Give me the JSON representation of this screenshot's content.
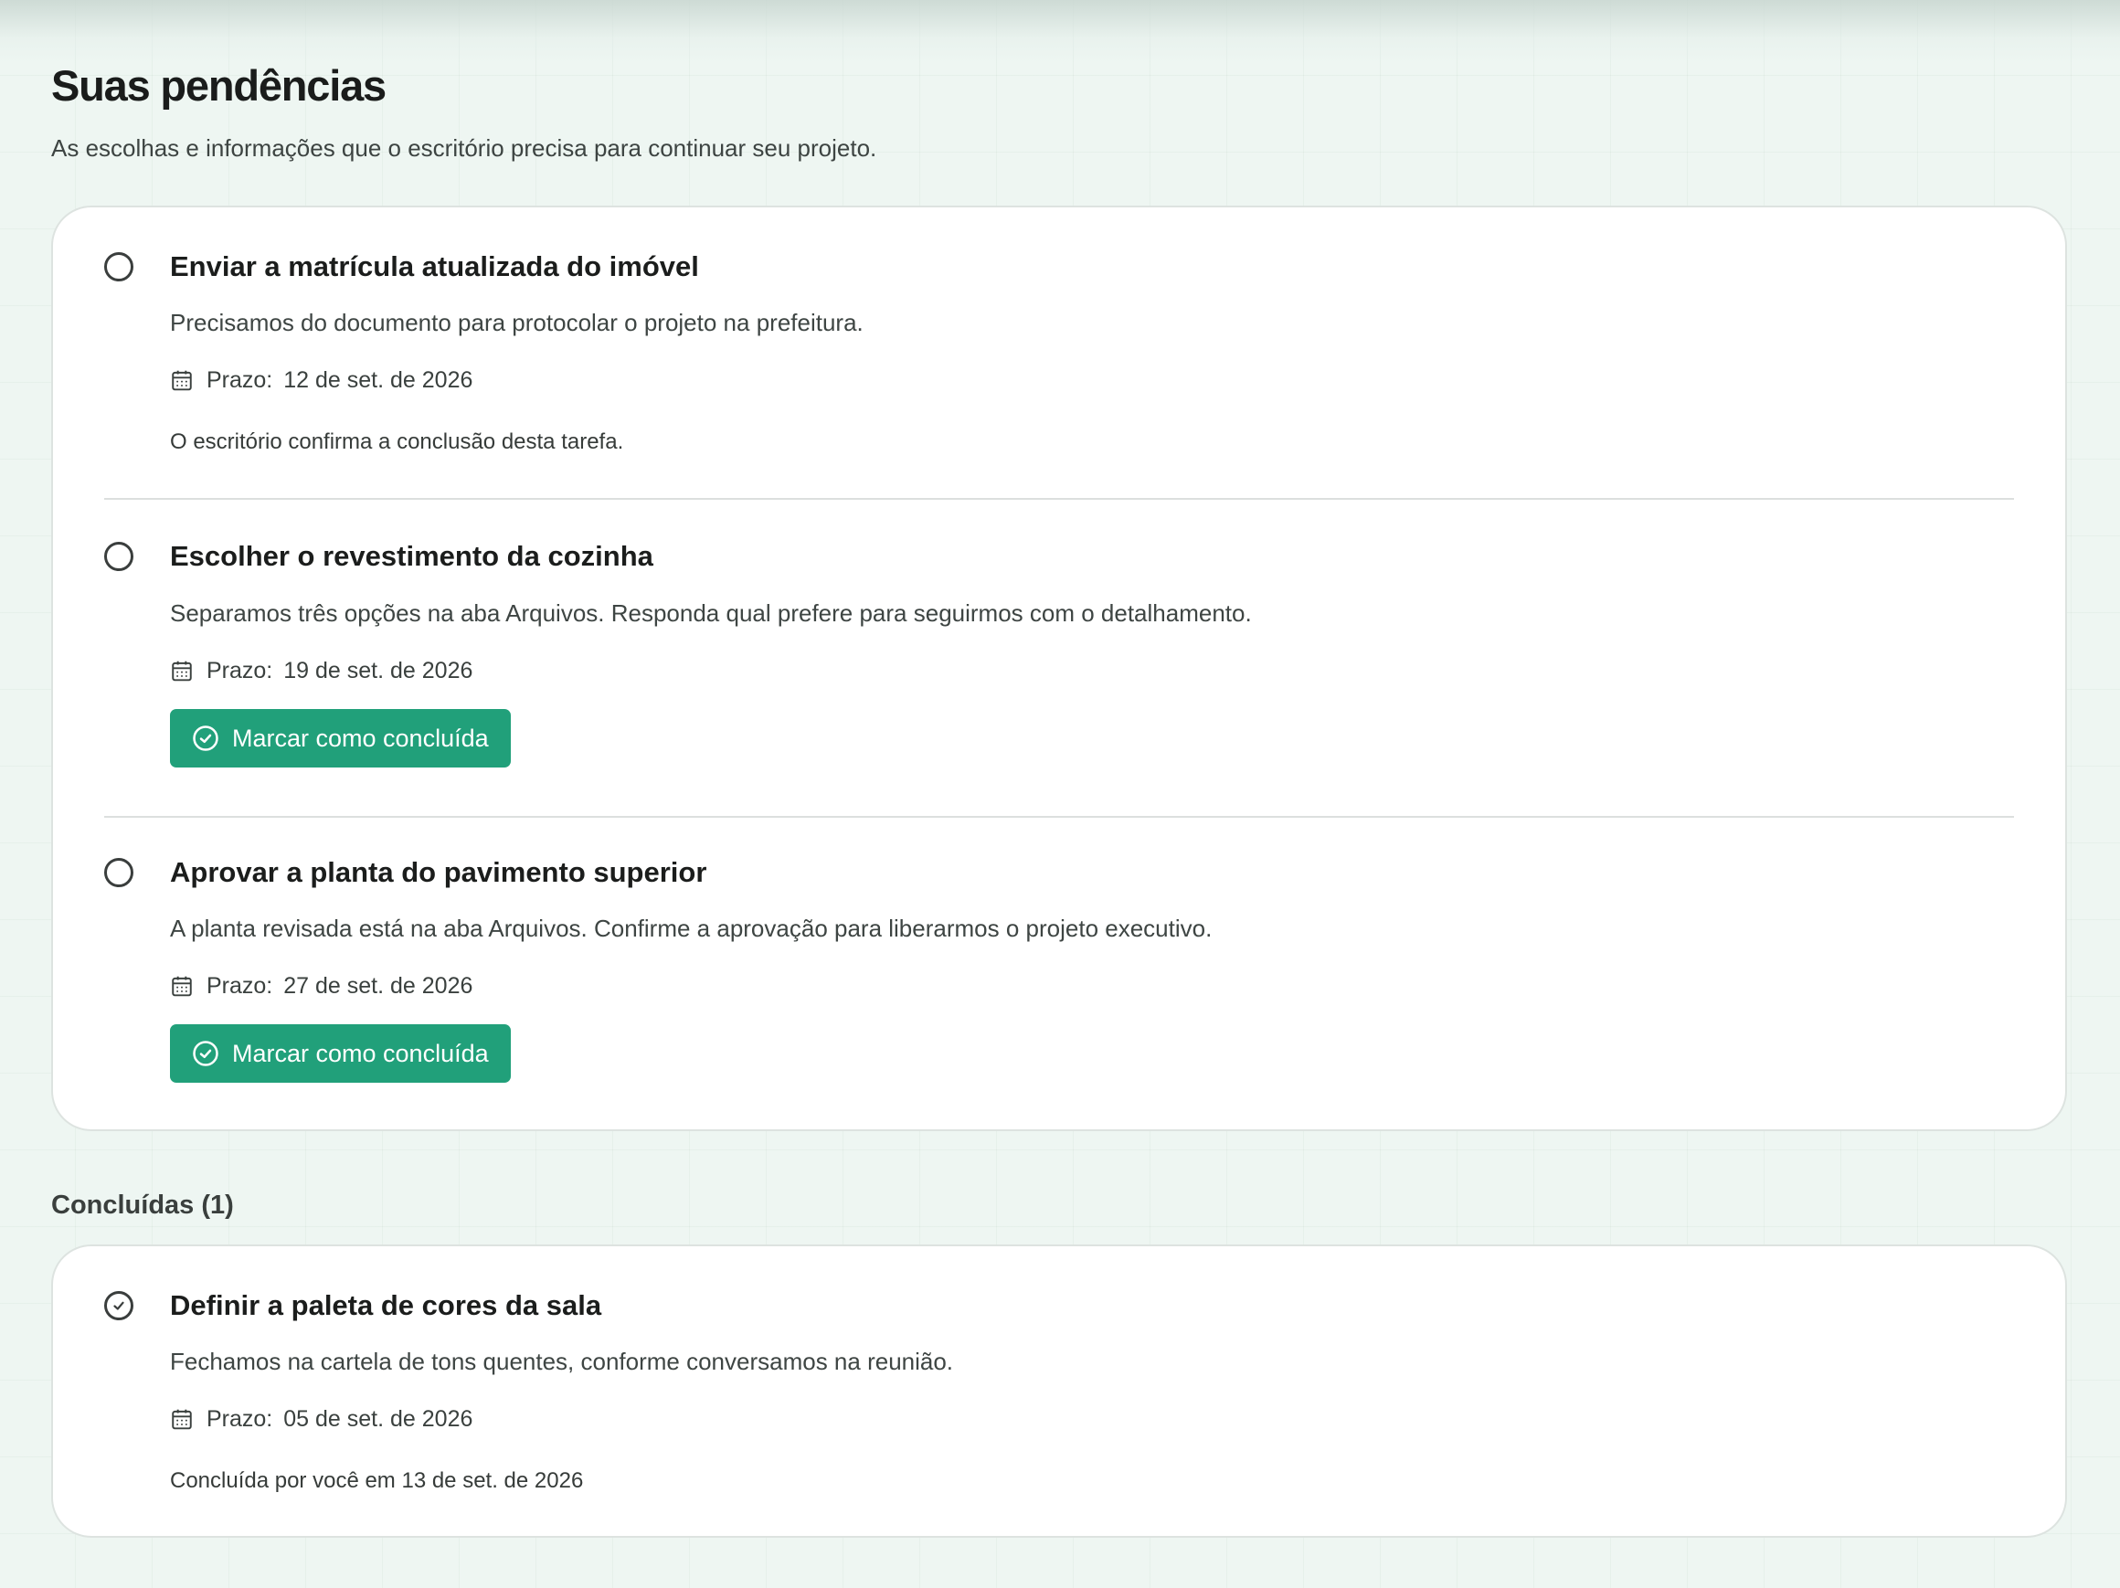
{
  "header": {
    "title": "Suas pendências",
    "subtitle": "As escolhas e informações que o escritório precisa para continuar seu projeto."
  },
  "pending": {
    "tasks": [
      {
        "title": "Enviar a matrícula atualizada do imóvel",
        "description": "Precisamos do documento para protocolar o projeto na prefeitura.",
        "deadline_label": "Prazo:",
        "deadline": "12 de set. de 2026",
        "note": "O escritório confirma a conclusão desta tarefa.",
        "status": "pending"
      },
      {
        "title": "Escolher o revestimento da cozinha",
        "description": "Separamos três opções na aba Arquivos. Responda qual prefere para seguirmos com o detalhamento.",
        "deadline_label": "Prazo:",
        "deadline": "19 de set. de 2026",
        "button_label": "Marcar como concluída",
        "status": "pending"
      },
      {
        "title": "Aprovar a planta do pavimento superior",
        "description": "A planta revisada está na aba Arquivos. Confirme a aprovação para liberarmos o projeto executivo.",
        "deadline_label": "Prazo:",
        "deadline": "27 de set. de 2026",
        "button_label": "Marcar como concluída",
        "status": "pending"
      }
    ]
  },
  "completed": {
    "heading": "Concluídas (1)",
    "tasks": [
      {
        "title": "Definir a paleta de cores da sala",
        "description": "Fechamos na cartela de tons quentes, conforme conversamos na reunião.",
        "deadline_label": "Prazo:",
        "deadline": "05 de set. de 2026",
        "note": "Concluída por você em 13 de set. de 2026",
        "status": "done"
      }
    ]
  },
  "icons": {
    "status_pending": "empty-circle-icon",
    "status_done": "check-circle-icon",
    "deadline": "calendar-icon",
    "button": "check-circle-icon"
  },
  "colors": {
    "accent": "#21a07a",
    "background": "#eef6f2",
    "card": "#ffffff"
  }
}
